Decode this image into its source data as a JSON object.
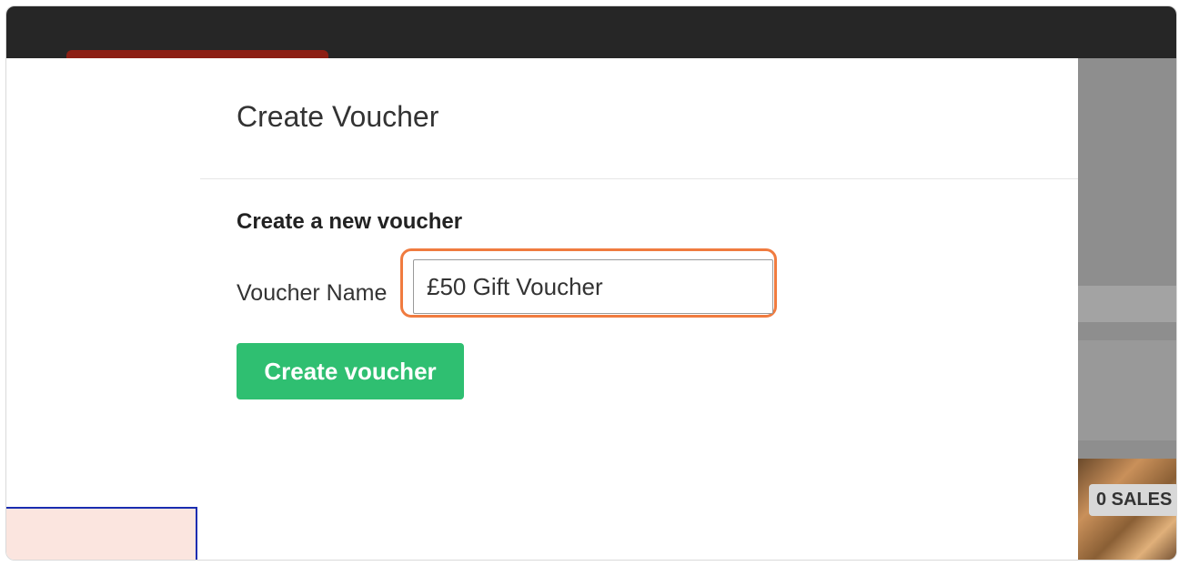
{
  "modal": {
    "title": "Create Voucher",
    "section_heading": "Create a new voucher",
    "voucher_name_label": "Voucher Name",
    "voucher_name_value": "£50 Gift Voucher",
    "create_button_label": "Create voucher"
  },
  "background": {
    "sales_badge": "0 SALES"
  },
  "colors": {
    "accent_green": "#2fbf71",
    "focus_orange": "#f07b3f",
    "topbar": "#262626",
    "brand_red": "#8c1f14"
  }
}
